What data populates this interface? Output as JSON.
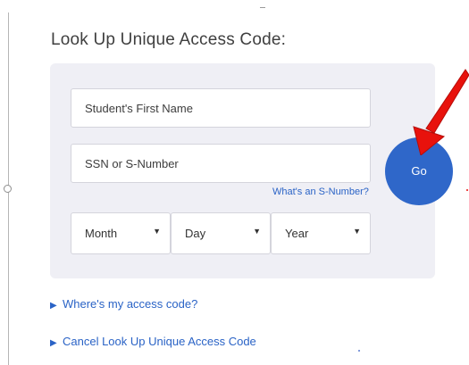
{
  "title": "Look Up Unique Access Code:",
  "form": {
    "first_name_placeholder": "Student's First Name",
    "ssn_placeholder": "SSN or S-Number",
    "help_link": "What's an S-Number?",
    "month_label": "Month",
    "day_label": "Day",
    "year_label": "Year",
    "caret": "▼",
    "go_label": "Go"
  },
  "links": {
    "bullet": "▶",
    "access_code": "Where's my access code?",
    "cancel": "Cancel Look Up Unique Access Code"
  },
  "colors": {
    "accent": "#2f67c9",
    "link": "#2a63c6",
    "panel_bg": "#efeff5",
    "annotation_arrow": "#e8120c"
  }
}
